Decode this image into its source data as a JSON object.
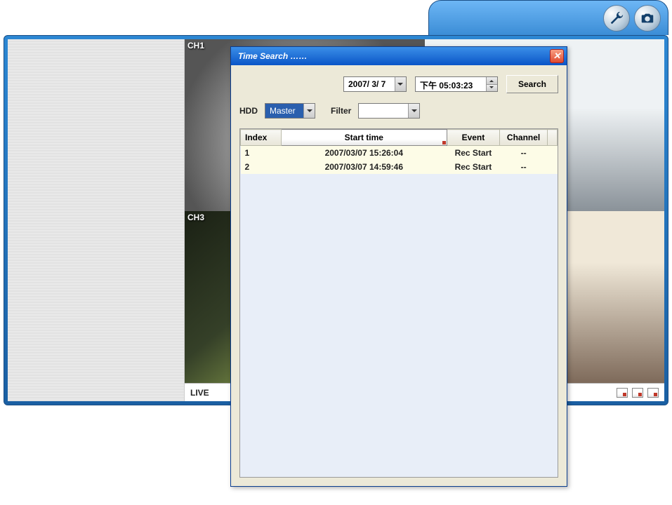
{
  "topbar": {
    "settings_icon": "wrench-icon",
    "camera_icon": "camera-icon"
  },
  "channels": {
    "ch1": "CH1",
    "ch3": "CH3"
  },
  "statusbar": {
    "live": "LIVE"
  },
  "dialog": {
    "title": "Time Search ……",
    "date": "2007/ 3/ 7",
    "time": "下午 05:03:23",
    "search_btn": "Search",
    "hdd_label": "HDD",
    "hdd_value": "Master",
    "filter_label": "Filter",
    "filter_value": "",
    "columns": {
      "index": "Index",
      "start": "Start time",
      "event": "Event",
      "channel": "Channel"
    },
    "rows": [
      {
        "index": "1",
        "start": "2007/03/07  15:26:04",
        "event": "Rec Start",
        "channel": "--"
      },
      {
        "index": "2",
        "start": "2007/03/07  14:59:46",
        "event": "Rec Start",
        "channel": "--"
      }
    ]
  }
}
